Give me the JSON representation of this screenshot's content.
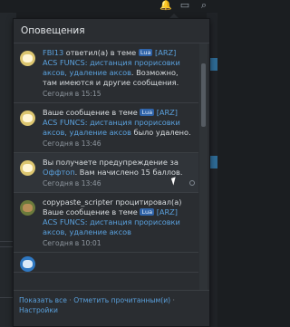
{
  "popup": {
    "title": "Оповещения",
    "notifications": [
      {
        "user": "FBI13",
        "action": "ответил(а) в теме",
        "prefix": "Lua",
        "thread": "[ARZ] ACS FUNCS: дистанция прорисовки аксов, удаление аксов",
        "suffix": ". Возможно, там имеются и другие сообщения.",
        "time": "Сегодня в 15:15"
      },
      {
        "intro": "Ваше сообщение в теме",
        "prefix": "Lua",
        "thread": "[ARZ] ACS FUNCS: дистанция прорисовки аксов, удаление аксов",
        "suffix": "было удалено.",
        "time": "Сегодня в 13:46"
      },
      {
        "intro": "Вы получаете предупреждение за",
        "link": "Оффтоп",
        "suffix": ". Вам начислено 15 баллов.",
        "time": "Сегодня в 13:46"
      },
      {
        "user": "copypaste_scripter",
        "action": "процитировал(а)",
        "intro": "Ваше сообщение в теме",
        "prefix": "Lua",
        "thread": "[ARZ] ACS FUNCS: дистанция прорисовки аксов, удаление аксов",
        "time": "Сегодня в 10:01"
      }
    ],
    "footer": {
      "show_all": "Показать все",
      "separator": " · ",
      "mark_read": "Отметить прочитанным(и)",
      "settings": "Настройки"
    }
  }
}
